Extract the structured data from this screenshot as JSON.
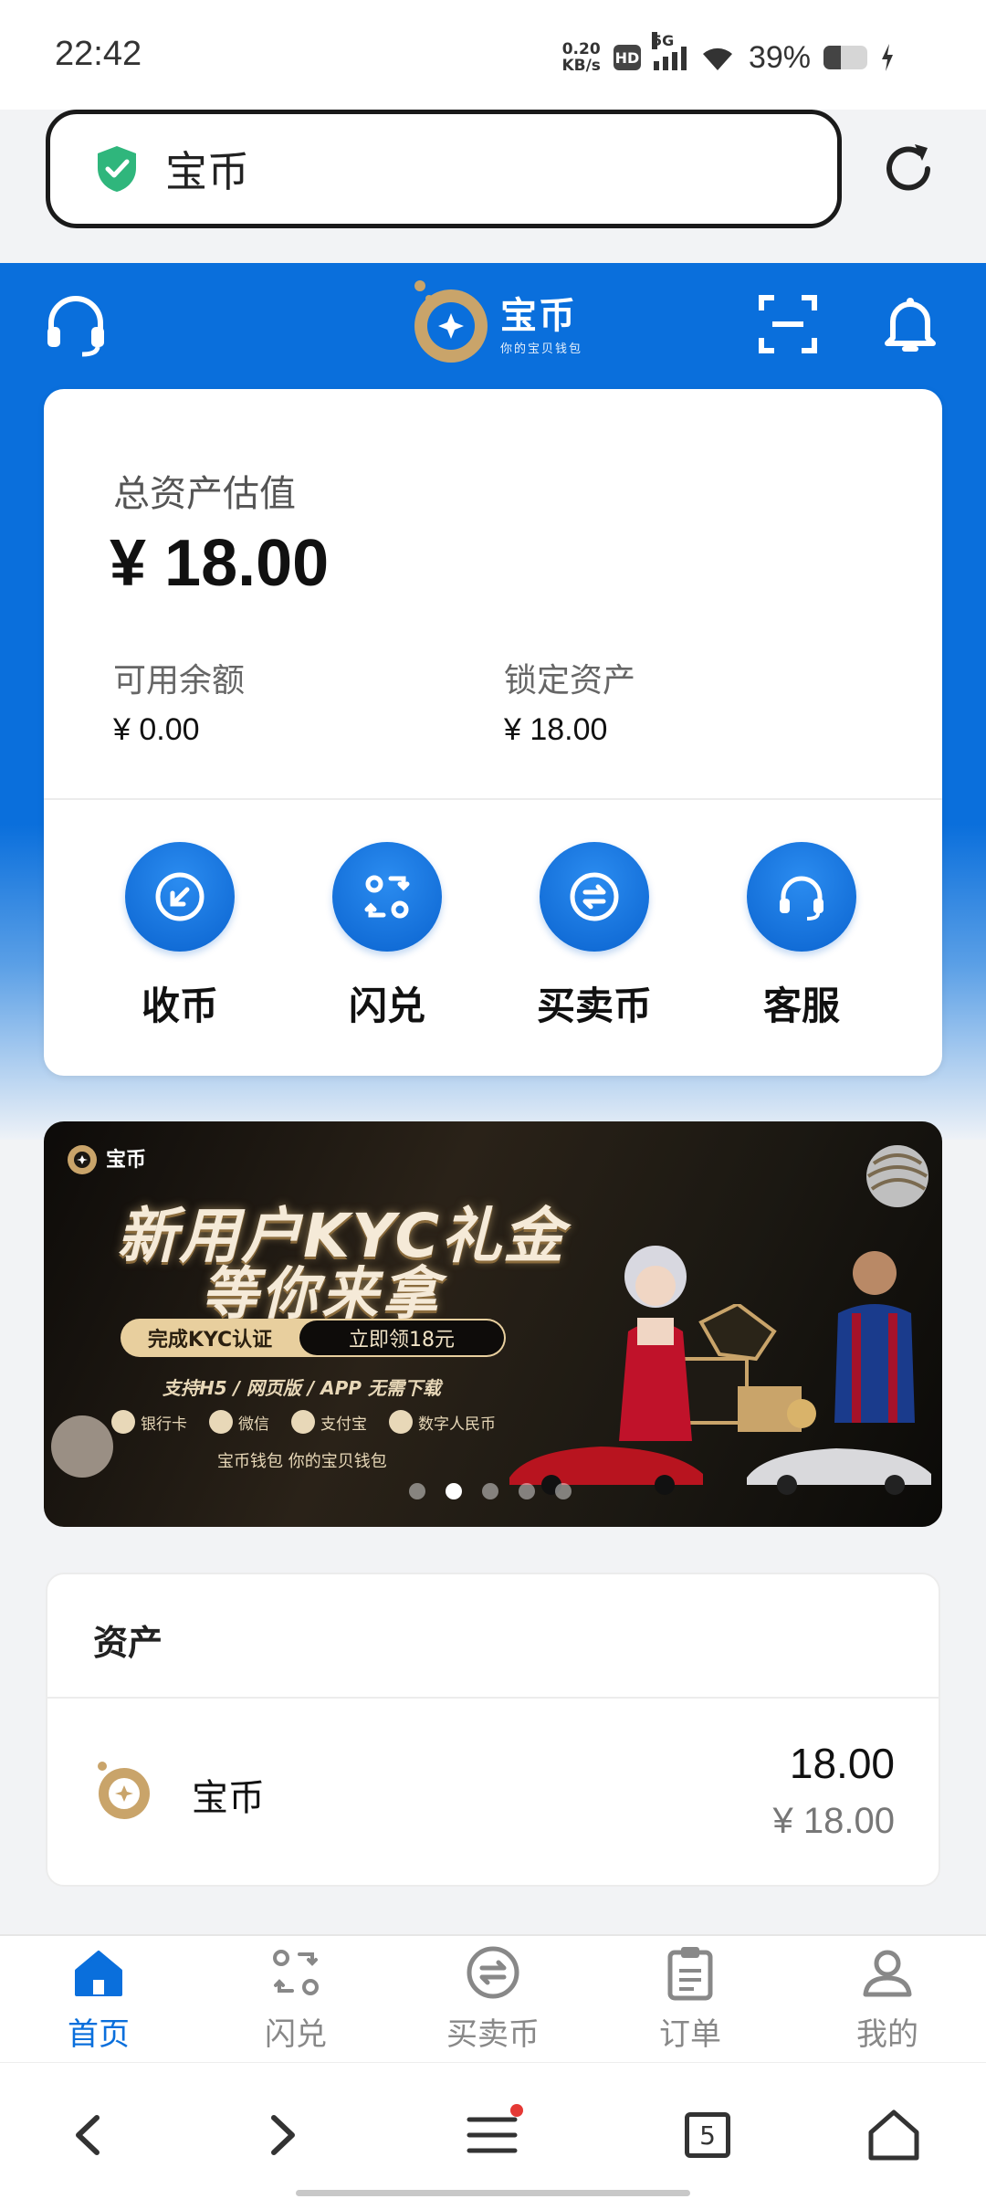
{
  "status_bar": {
    "time": "22:42",
    "net_speed_value": "0.20",
    "net_speed_unit": "KB/s",
    "hd": "HD",
    "network": "5G",
    "battery": "39%",
    "battery_level": 0.39
  },
  "browser": {
    "url_text": "宝币",
    "secure": true
  },
  "header": {
    "brand": "宝币",
    "tagline": "你的宝贝钱包",
    "colors": {
      "primary": "#0a6fdc",
      "gold": "#c9a46a"
    }
  },
  "asset_card": {
    "label": "总资产估值",
    "total": "¥ 18.00",
    "available_label": "可用余额",
    "available_value": "¥ 0.00",
    "locked_label": "锁定资产",
    "locked_value": "¥ 18.00",
    "actions": [
      {
        "label": "收币",
        "icon": "receive-icon"
      },
      {
        "label": "闪兑",
        "icon": "swap-icon"
      },
      {
        "label": "买卖币",
        "icon": "trade-icon"
      },
      {
        "label": "客服",
        "icon": "headset-icon"
      }
    ]
  },
  "banner": {
    "brand": "宝币",
    "title_line1": "新用户KYC礼金",
    "title_line2": "等你来拿",
    "pill_left": "完成KYC认证",
    "pill_right": "立即领18元",
    "support_text": "支持H5 / 网页版 / APP 无需下载",
    "payments": [
      "银行卡",
      "微信",
      "支付宝",
      "数字人民币"
    ],
    "slogan": "宝币钱包 你的宝贝钱包",
    "dot_count": 5,
    "active_dot": 1
  },
  "assets": {
    "header": "资产",
    "items": [
      {
        "name": "宝币",
        "amount": "18.00",
        "cny": "¥ 18.00"
      }
    ]
  },
  "tab_bar": [
    {
      "label": "首页",
      "icon": "home-icon",
      "active": true
    },
    {
      "label": "闪兑",
      "icon": "swap-icon",
      "active": false
    },
    {
      "label": "买卖币",
      "icon": "trade-icon",
      "active": false
    },
    {
      "label": "订单",
      "icon": "clipboard-icon",
      "active": false
    },
    {
      "label": "我的",
      "icon": "user-icon",
      "active": false
    }
  ],
  "nav_bar": {
    "tab_count": "5"
  }
}
